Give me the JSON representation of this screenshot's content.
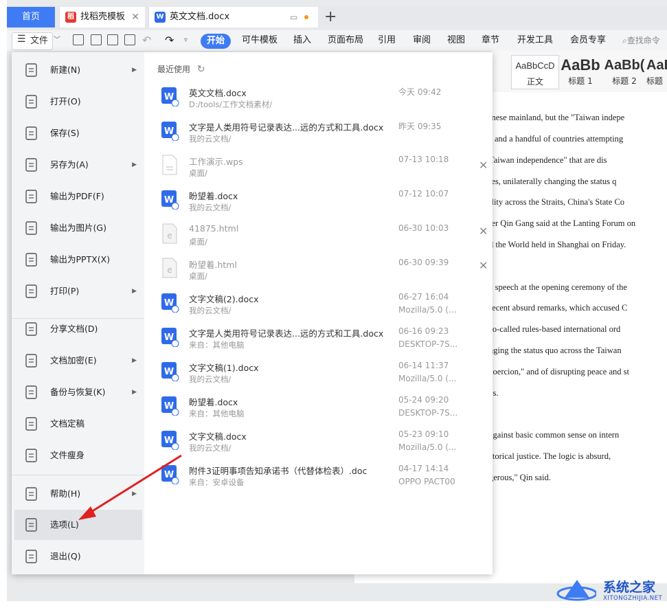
{
  "tabs": {
    "home": "首页",
    "tab1": "找稻壳模板",
    "tab2": "英文文档.docx"
  },
  "menubar": {
    "file": "文件",
    "items": [
      "开始",
      "可牛模板",
      "插入",
      "页面布局",
      "引用",
      "审阅",
      "视图",
      "章节",
      "开发工具",
      "会员专享"
    ],
    "search": "查找命令"
  },
  "styles": [
    {
      "preview": "AaBbCcD",
      "name": "正文"
    },
    {
      "preview": "AaBb",
      "name": "标题 1"
    },
    {
      "preview": "AaBb(",
      "name": "标题 2"
    },
    {
      "preview": "AaB",
      "name": "标题"
    }
  ],
  "file_menu": {
    "items": [
      {
        "label": "新建(N)",
        "icon": "new-file-icon",
        "arrow": true
      },
      {
        "label": "打开(O)",
        "icon": "folder-open-icon",
        "arrow": false
      },
      {
        "label": "保存(S)",
        "icon": "save-icon",
        "arrow": false
      },
      {
        "label": "另存为(A)",
        "icon": "save-as-icon",
        "arrow": true
      },
      {
        "label": "输出为PDF(F)",
        "icon": "export-pdf-icon",
        "arrow": false
      },
      {
        "label": "输出为图片(G)",
        "icon": "export-image-icon",
        "arrow": false
      },
      {
        "label": "输出为PPTX(X)",
        "icon": "export-pptx-icon",
        "arrow": false
      },
      {
        "label": "打印(P)",
        "icon": "printer-icon",
        "arrow": true
      },
      {
        "label": "分享文档(D)",
        "icon": "share-icon",
        "arrow": false
      },
      {
        "label": "文档加密(E)",
        "icon": "encrypt-icon",
        "arrow": true
      },
      {
        "label": "备份与恢复(K)",
        "icon": "backup-icon",
        "arrow": true
      },
      {
        "label": "文档定稿",
        "icon": "finalize-icon",
        "arrow": false
      },
      {
        "label": "文件瘦身",
        "icon": "slim-icon",
        "arrow": false
      },
      {
        "label": "帮助(H)",
        "icon": "help-icon",
        "arrow": true
      },
      {
        "label": "选项(L)",
        "icon": "gear-icon",
        "arrow": false
      },
      {
        "label": "退出(Q)",
        "icon": "exit-icon",
        "arrow": false
      }
    ]
  },
  "recent": {
    "header": "最近使用",
    "files": [
      {
        "name": "英文文档.docx",
        "path": "D:/tools/工作文档素材/",
        "time": "今天  09:42",
        "source": "",
        "type": "docx"
      },
      {
        "name": "文字是人类用符号记录表达...远的方式和工具.docx",
        "path": "我的云文档/",
        "time": "昨天  09:35",
        "source": "",
        "type": "docx"
      },
      {
        "name": "工作演示.wps",
        "path": "桌面/",
        "time": "07-13 10:18",
        "source": "",
        "type": "wps"
      },
      {
        "name": "盼望着.docx",
        "path": "我的云文档/",
        "time": "07-12 10:07",
        "source": "",
        "type": "docx"
      },
      {
        "name": "41875.html",
        "path": "桌面/",
        "time": "06-30 10:03",
        "source": "",
        "type": "html"
      },
      {
        "name": "盼望着.html",
        "path": "桌面/",
        "time": "06-30 09:39",
        "source": "",
        "type": "html"
      },
      {
        "name": "文字文稿(2).docx",
        "path": "我的云文档/",
        "time": "06-27 16:04",
        "source": "Mozilla/5.0 (...",
        "type": "docx"
      },
      {
        "name": "文字是人类用符号记录表达...远的方式和工具.docx",
        "path": "来自：其他电脑",
        "time": "06-16 09:23",
        "source": "DESKTOP-7S...",
        "type": "docx"
      },
      {
        "name": "文字文稿(1).docx",
        "path": "我的云文档/",
        "time": "06-14 11:37",
        "source": "Mozilla/5.0 (...",
        "type": "docx"
      },
      {
        "name": "盼望着.docx",
        "path": "来自：其他电脑",
        "time": "05-24 09:20",
        "source": "DESKTOP-7S...",
        "type": "docx"
      },
      {
        "name": "文字文稿.docx",
        "path": "我的云文档/",
        "time": "05-23 09:10",
        "source": "Mozilla/5.0 (...",
        "type": "docx"
      },
      {
        "name": "附件3证明事项告知承诺书（代替体检表）.doc",
        "path": "来自：安卓设备",
        "time": "04-17 14:14",
        "source": "OPPO PACT00",
        "type": "docx"
      }
    ]
  },
  "doc_lines": [
    "inese mainland, but the \"Taiwan indepe",
    "s and a handful of countries attempting",
    "Taiwan  independence\"  that  are  dis",
    "ies, unilaterally changing the status q",
    "ility across the Straits, China's State Co",
    "ter Qin Gang said at the Lanting Forum on",
    "d the World held in Shanghai on Friday.",
    "a speech at the opening ceremony of the",
    "recent absurd remarks, which accused C",
    "so-called rules-based international ord",
    "nging the status quo across the Taiwan",
    "coercion,\" and of disrupting peace and st",
    "cs.",
    "against basic common sense on intern",
    "storical justice. The logic is absurd,",
    "gerous,\" Qin said."
  ],
  "watermark": {
    "title": "系统之家",
    "url": "XITONGZHIJIA.NET"
  },
  "colors": {
    "accent": "#3f7cf4",
    "arrow": "#e02020"
  }
}
